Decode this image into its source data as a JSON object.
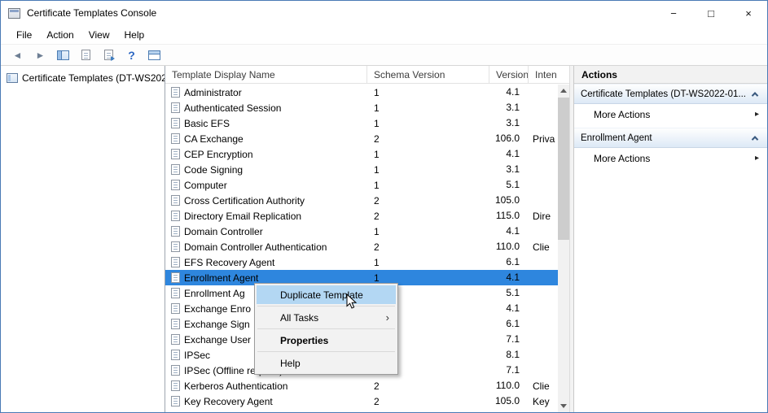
{
  "window": {
    "title": "Certificate Templates Console",
    "minimize_glyph": "−",
    "maximize_glyph": "□",
    "close_glyph": "×"
  },
  "menu": {
    "items": [
      "File",
      "Action",
      "View",
      "Help"
    ]
  },
  "toolbar": {
    "buttons": [
      "back",
      "forward",
      "show-console-tree",
      "export-list",
      "help",
      "table-view"
    ],
    "glyphs": {
      "back": "◄",
      "forward": "►",
      "help": "?"
    }
  },
  "tree": {
    "root_label": "Certificate Templates (DT-WS202"
  },
  "list": {
    "columns": [
      "Template Display Name",
      "Schema Version",
      "Version",
      "Inten"
    ],
    "rows": [
      {
        "name": "Administrator",
        "schema": "1",
        "version": "4.1",
        "intended": ""
      },
      {
        "name": "Authenticated Session",
        "schema": "1",
        "version": "3.1",
        "intended": ""
      },
      {
        "name": "Basic EFS",
        "schema": "1",
        "version": "3.1",
        "intended": ""
      },
      {
        "name": "CA Exchange",
        "schema": "2",
        "version": "106.0",
        "intended": "Priva"
      },
      {
        "name": "CEP Encryption",
        "schema": "1",
        "version": "4.1",
        "intended": ""
      },
      {
        "name": "Code Signing",
        "schema": "1",
        "version": "3.1",
        "intended": ""
      },
      {
        "name": "Computer",
        "schema": "1",
        "version": "5.1",
        "intended": ""
      },
      {
        "name": "Cross Certification Authority",
        "schema": "2",
        "version": "105.0",
        "intended": ""
      },
      {
        "name": "Directory Email Replication",
        "schema": "2",
        "version": "115.0",
        "intended": "Dire"
      },
      {
        "name": "Domain Controller",
        "schema": "1",
        "version": "4.1",
        "intended": ""
      },
      {
        "name": "Domain Controller Authentication",
        "schema": "2",
        "version": "110.0",
        "intended": "Clie"
      },
      {
        "name": "EFS Recovery Agent",
        "schema": "1",
        "version": "6.1",
        "intended": ""
      },
      {
        "name": "Enrollment Agent",
        "schema": "1",
        "version": "4.1",
        "intended": "",
        "selected": true
      },
      {
        "name": "Enrollment Ag",
        "schema": "",
        "version": "5.1",
        "intended": ""
      },
      {
        "name": "Exchange Enro",
        "schema": "",
        "version": "4.1",
        "intended": ""
      },
      {
        "name": "Exchange Sign",
        "schema": "",
        "version": "6.1",
        "intended": ""
      },
      {
        "name": "Exchange User",
        "schema": "",
        "version": "7.1",
        "intended": ""
      },
      {
        "name": "IPSec",
        "schema": "",
        "version": "8.1",
        "intended": ""
      },
      {
        "name": "IPSec (Offline request)",
        "schema": "",
        "version": "7.1",
        "intended": ""
      },
      {
        "name": "Kerberos Authentication",
        "schema": "2",
        "version": "110.0",
        "intended": "Clie"
      },
      {
        "name": "Key Recovery Agent",
        "schema": "2",
        "version": "105.0",
        "intended": "Key"
      }
    ]
  },
  "context_menu": {
    "duplicate": "Duplicate Template",
    "all_tasks": "All Tasks",
    "properties": "Properties",
    "help": "Help",
    "submenu_arrow": "›"
  },
  "actions": {
    "title": "Actions",
    "groups": [
      {
        "header": "Certificate Templates (DT-WS2022-01...",
        "item": "More Actions"
      },
      {
        "header": "Enrollment Agent",
        "item": "More Actions"
      }
    ],
    "more_arrow": "▸"
  },
  "colors": {
    "selection-blue": "#2e86de",
    "menu-highlight": "#b3d7f3"
  }
}
